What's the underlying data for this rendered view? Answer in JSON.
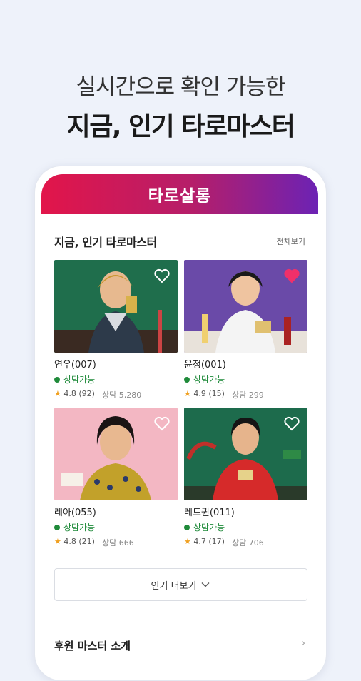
{
  "promo": {
    "subtitle": "실시간으로 확인 가능한",
    "title": "지금, 인기 타로마스터"
  },
  "app": {
    "brand": "타로살롱",
    "accent_start": "#e2154a",
    "accent_end": "#6c22b4"
  },
  "section": {
    "title": "지금, 인기 타로마스터",
    "view_all": "전체보기"
  },
  "masters": [
    {
      "name": "연우(007)",
      "status": "상담가능",
      "rating": "4.8",
      "reviews": "(92)",
      "consult": "상담 5,280",
      "liked": false,
      "bg": "#1f6e4c"
    },
    {
      "name": "윤정(001)",
      "status": "상담가능",
      "rating": "4.9",
      "reviews": "(15)",
      "consult": "상담 299",
      "liked": true,
      "bg": "#6a4aa8"
    },
    {
      "name": "레아(055)",
      "status": "상담가능",
      "rating": "4.8",
      "reviews": "(21)",
      "consult": "상담 666",
      "liked": false,
      "bg": "#f3b7c3"
    },
    {
      "name": "레드퀸(011)",
      "status": "상담가능",
      "rating": "4.7",
      "reviews": "(17)",
      "consult": "상담 706",
      "liked": false,
      "bg": "#1d6b4c"
    }
  ],
  "more_button": {
    "label": "인기 더보기"
  },
  "next_section": {
    "title": "후원 마스터 소개"
  },
  "icons": {
    "heart": "heart-icon",
    "star": "star-icon",
    "chevron": "chevron-down-icon"
  }
}
